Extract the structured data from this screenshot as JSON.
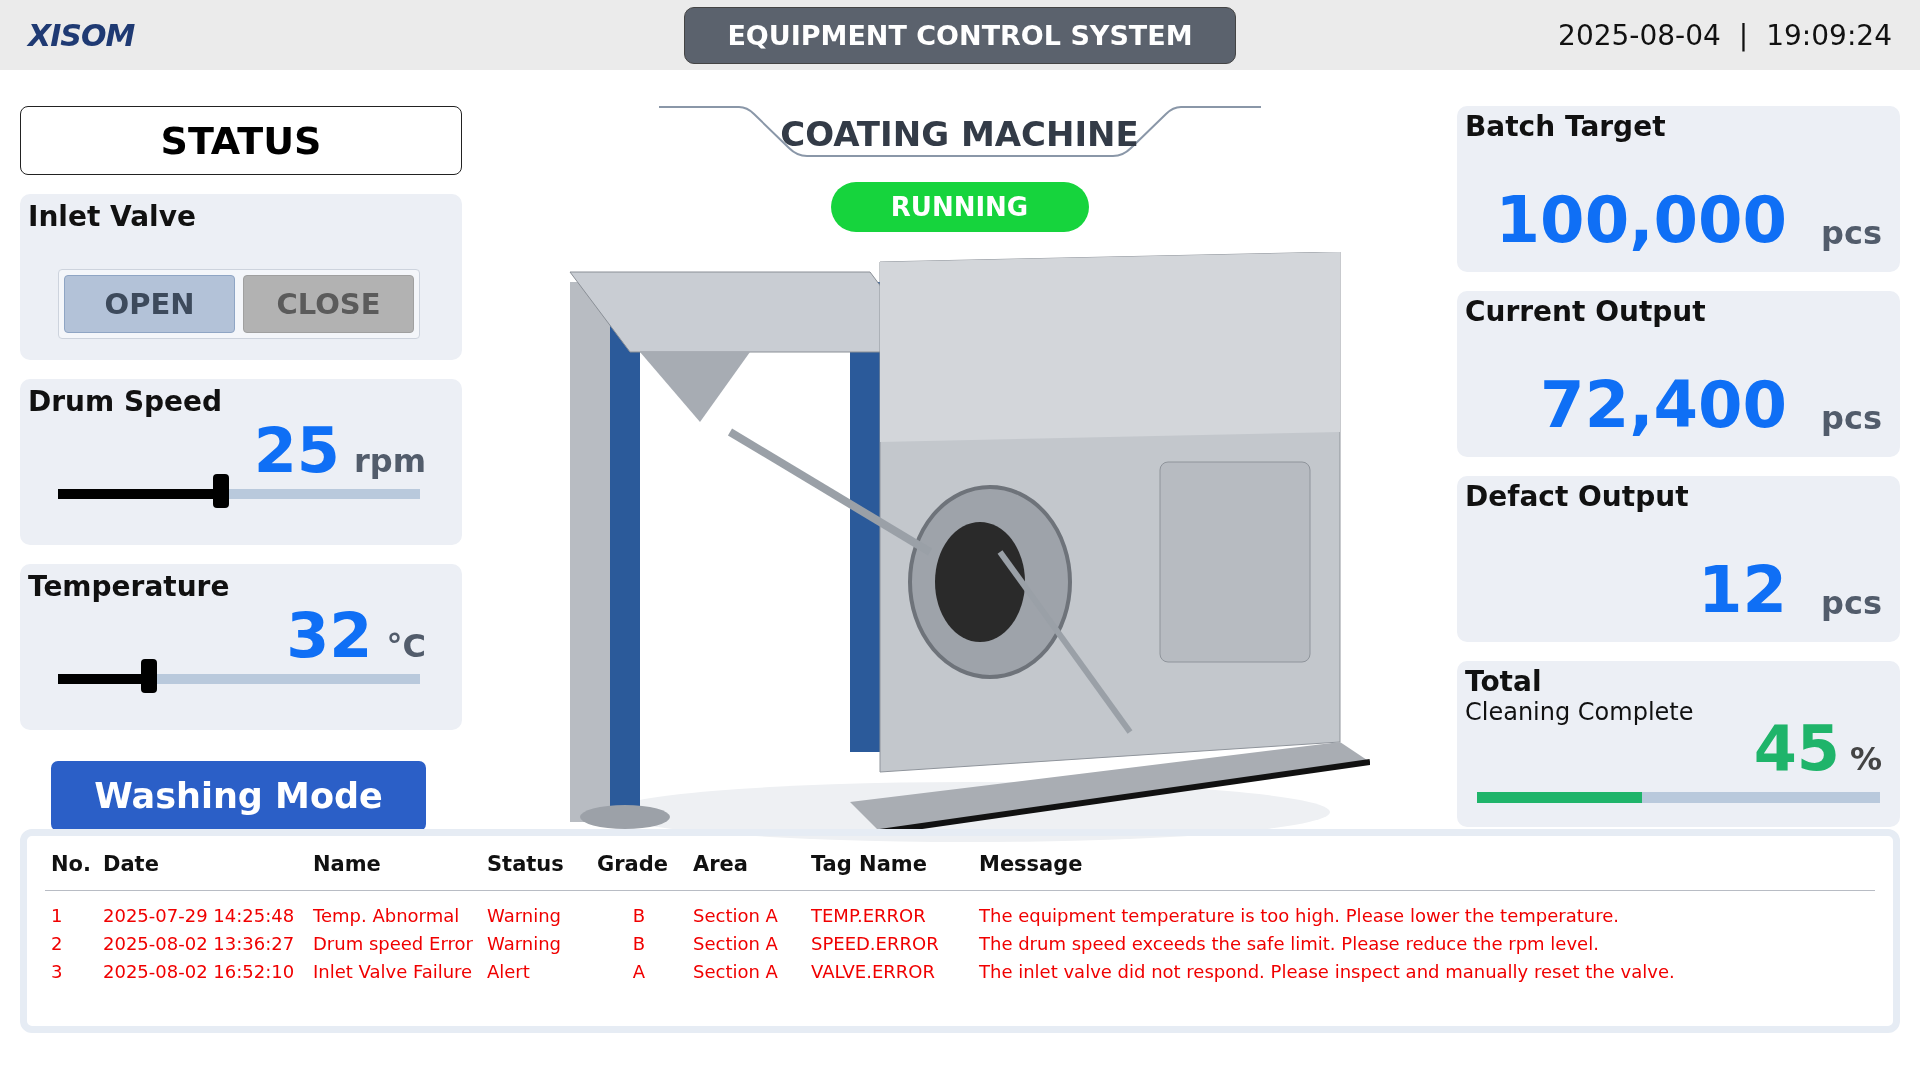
{
  "header": {
    "logo": "XISOM",
    "title": "EQUIPMENT CONTROL SYSTEM",
    "date": "2025-08-04",
    "separator": "|",
    "time": "19:09:24"
  },
  "status_panel": {
    "title": "STATUS",
    "inlet_valve": {
      "label": "Inlet Valve",
      "options": [
        {
          "label": "OPEN",
          "selected": true
        },
        {
          "label": "CLOSE",
          "selected": false
        }
      ]
    },
    "gauges": [
      {
        "label": "Drum Speed",
        "value": "25",
        "unit": "rpm",
        "level": 0.45
      },
      {
        "label": "Temperature",
        "value": "32",
        "unit": "°C",
        "level": 0.25
      }
    ],
    "washing_button": "Washing Mode"
  },
  "machine": {
    "title": "COATING MACHINE",
    "state": "RUNNING",
    "running": true
  },
  "counters": [
    {
      "label": "Batch Target",
      "value": "100,000",
      "unit": "pcs"
    },
    {
      "label": "Current Output",
      "value": "72,400",
      "unit": "pcs"
    },
    {
      "label": "Defact Output",
      "value": "12",
      "unit": "pcs"
    }
  ],
  "cleaning": {
    "title": "Total",
    "subtitle": "Cleaning Complete",
    "value": "45",
    "unit": "%",
    "level": 0.41
  },
  "alarm_table": {
    "columns": [
      "No.",
      "Date",
      "Name",
      "Status",
      "Grade",
      "Area",
      "Tag Name",
      "Message"
    ],
    "rows": [
      [
        "1",
        "2025-07-29 14:25:48",
        "Temp. Abnormal",
        "Warning",
        "B",
        "Section A",
        "TEMP.ERROR",
        "The equipment temperature is too high. Please lower the temperature."
      ],
      [
        "2",
        "2025-08-02 13:36:27",
        "Drum speed Error",
        "Warning",
        "B",
        "Section A",
        "SPEED.ERROR",
        "The drum speed exceeds the safe limit. Please reduce the rpm level."
      ],
      [
        "3",
        "2025-08-02 16:52:10",
        "Inlet Valve Failure",
        "Alert",
        "A",
        "Section A",
        "VALVE.ERROR",
        "The inlet valve did not respond. Please inspect and manually reset the valve."
      ]
    ]
  }
}
